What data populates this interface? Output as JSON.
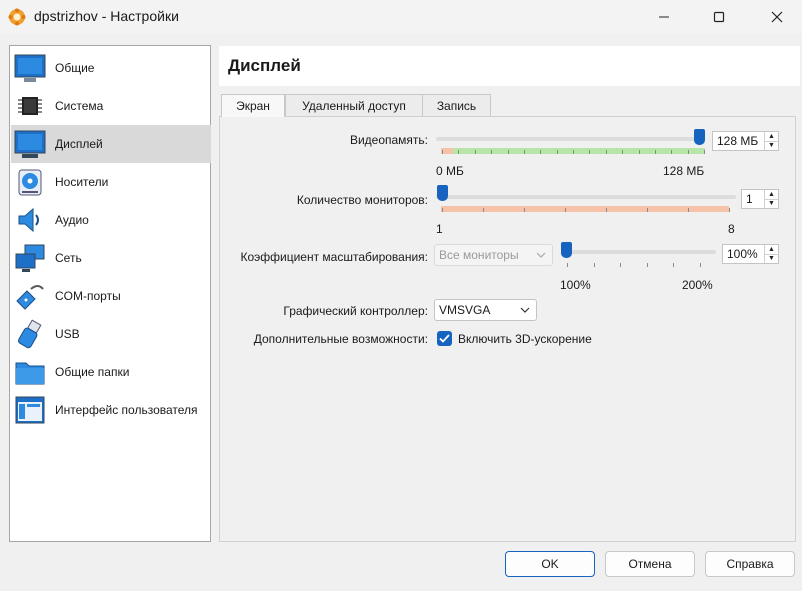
{
  "window": {
    "title": "dpstrizhov - Настройки",
    "icon": "virtualbox-gear-icon"
  },
  "sidebar": {
    "items": [
      {
        "label": "Общие",
        "icon": "general-monitor-icon",
        "selected": false
      },
      {
        "label": "Система",
        "icon": "chip-icon",
        "selected": false
      },
      {
        "label": "Дисплей",
        "icon": "display-icon",
        "selected": true
      },
      {
        "label": "Носители",
        "icon": "storage-disc-icon",
        "selected": false
      },
      {
        "label": "Аудио",
        "icon": "speaker-icon",
        "selected": false
      },
      {
        "label": "Сеть",
        "icon": "network-icon",
        "selected": false
      },
      {
        "label": "COM-порты",
        "icon": "serial-port-icon",
        "selected": false
      },
      {
        "label": "USB",
        "icon": "usb-icon",
        "selected": false
      },
      {
        "label": "Общие папки",
        "icon": "folder-icon",
        "selected": false
      },
      {
        "label": "Интерфейс пользователя",
        "icon": "ui-window-icon",
        "selected": false
      }
    ]
  },
  "page": {
    "title": "Дисплей",
    "tabs": [
      {
        "label": "Экран",
        "active": true
      },
      {
        "label": "Удаленный доступ",
        "active": false
      },
      {
        "label": "Запись",
        "active": false
      }
    ]
  },
  "screen": {
    "video_memory": {
      "label": "Видеопамять:",
      "value": "128 МБ",
      "level": 1.0,
      "min_label": "0 МБ",
      "max_label": "128 МБ"
    },
    "monitors": {
      "label": "Количество мониторов:",
      "value": "1",
      "level": 0.0,
      "min_label": "1",
      "max_label": "8"
    },
    "scale": {
      "label": "Коэффициент масштабирования:",
      "combo_value": "Все мониторы",
      "value": "100%",
      "level": 0.0,
      "min_label": "100%",
      "max_label": "200%"
    },
    "graphics_controller": {
      "label": "Графический контроллер:",
      "value": "VMSVGA"
    },
    "extended_features": {
      "label": "Дополнительные возможности:",
      "checkbox_label": "Включить 3D-ускорение",
      "checked": true
    }
  },
  "buttons": {
    "ok": "OK",
    "cancel": "Отмена",
    "help": "Справка"
  },
  "colors": {
    "accent": "#1764c0",
    "scale_good": "#b8e6a8",
    "scale_bad": "#f6c3a8",
    "selected_item": "#d9d9d9"
  }
}
